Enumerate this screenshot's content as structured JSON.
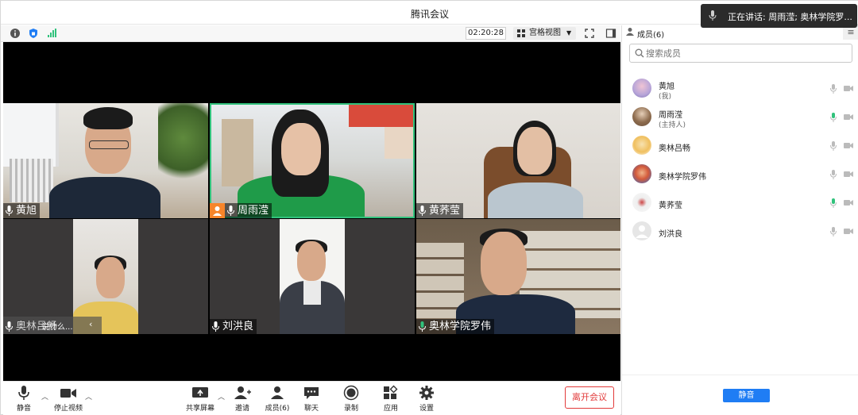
{
  "app": {
    "title": "腾讯会议"
  },
  "speaking": {
    "text": "正在讲话: 周雨滢; 奥林学院罗..."
  },
  "toolbar": {
    "timer": "02:20:28",
    "view_label": "宫格视图",
    "icons": [
      "info-icon",
      "shield-icon",
      "signal-icon",
      "fullscreen-icon",
      "sidebar-toggle-icon"
    ]
  },
  "tiles": [
    {
      "name": "黄旭"
    },
    {
      "name": "周雨滢",
      "host": true,
      "active": true
    },
    {
      "name": "黄荞莹"
    },
    {
      "name": "奥林吕畅",
      "overlay": "说什么..."
    },
    {
      "name": "刘洪良"
    },
    {
      "name": "奥林学院罗伟",
      "mic_color": "#31c27c"
    }
  ],
  "bottombar": {
    "mute": "静音",
    "stop_video": "停止视频",
    "share": "共享屏幕",
    "invite": "邀请",
    "members": "成员(6)",
    "chat": "聊天",
    "record": "录制",
    "apps": "应用",
    "settings": "设置",
    "leave": "离开会议"
  },
  "panel": {
    "title": "成员(6)",
    "search_placeholder": "搜索成员",
    "members": [
      {
        "name": "黄旭",
        "sub": "(我)",
        "mic_active": false
      },
      {
        "name": "周雨滢",
        "sub": "(主持人)",
        "mic_active": true
      },
      {
        "name": "奥林吕畅",
        "sub": "",
        "mic_active": false
      },
      {
        "name": "奥林学院罗伟",
        "sub": "",
        "mic_active": false
      },
      {
        "name": "黄荞莹",
        "sub": "",
        "mic_active": true
      },
      {
        "name": "刘洪良",
        "sub": "",
        "mic_active": false
      }
    ],
    "mute_all": "静音"
  },
  "colors": {
    "accent": "#1f7df4",
    "speaking_green": "#31c27c",
    "leave_red": "#e23a3a",
    "host_orange": "#f7852a"
  }
}
